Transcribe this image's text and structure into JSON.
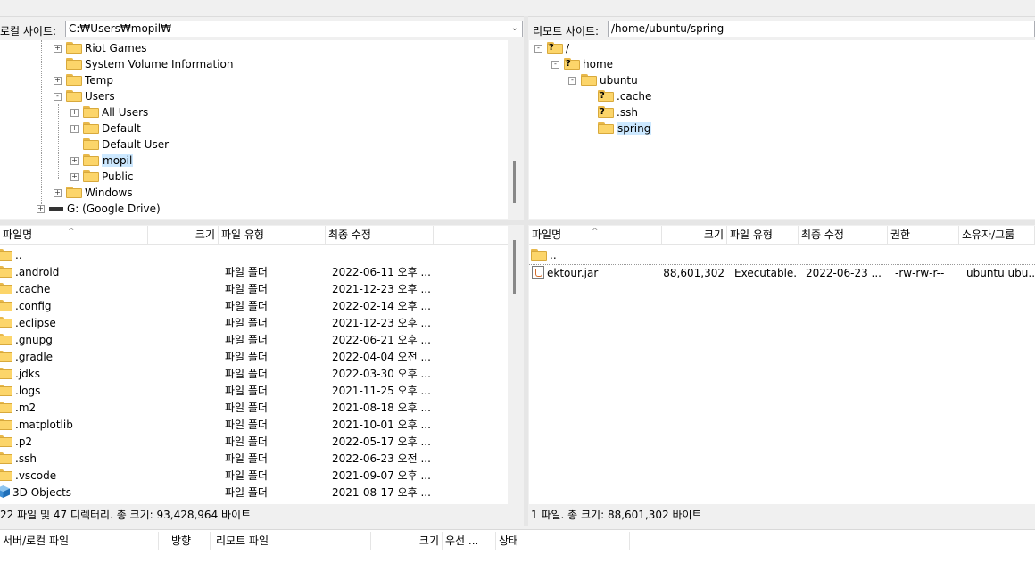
{
  "local_site": {
    "label": "로컬 사이트:",
    "path": "C:₩Users₩mopil₩"
  },
  "remote_site": {
    "label": "리모트 사이트:",
    "path": "/home/ubuntu/spring"
  },
  "local_tree": [
    {
      "name": "Riot Games"
    },
    {
      "name": "System Volume Information"
    },
    {
      "name": "Temp"
    },
    {
      "name": "Users"
    },
    {
      "name": "All Users"
    },
    {
      "name": "Default"
    },
    {
      "name": "Default User"
    },
    {
      "name": "mopil"
    },
    {
      "name": "Public"
    },
    {
      "name": "Windows"
    },
    {
      "name": "G: (Google Drive)"
    }
  ],
  "remote_tree": [
    {
      "name": "/"
    },
    {
      "name": "home"
    },
    {
      "name": "ubuntu"
    },
    {
      "name": ".cache"
    },
    {
      "name": ".ssh"
    },
    {
      "name": "spring"
    }
  ],
  "local_columns": [
    "파일명",
    "크기",
    "파일 유형",
    "최종 수정"
  ],
  "remote_columns": [
    "파일명",
    "크기",
    "파일 유형",
    "최종 수정",
    "권한",
    "소유자/그룹"
  ],
  "local_files": [
    {
      "name": "..",
      "type": "",
      "modified": ""
    },
    {
      "name": ".android",
      "type": "파일 폴더",
      "modified": "2022-06-11 오후 ..."
    },
    {
      "name": ".cache",
      "type": "파일 폴더",
      "modified": "2021-12-23 오후 ..."
    },
    {
      "name": ".config",
      "type": "파일 폴더",
      "modified": "2022-02-14 오후 ..."
    },
    {
      "name": ".eclipse",
      "type": "파일 폴더",
      "modified": "2021-12-23 오후 ..."
    },
    {
      "name": ".gnupg",
      "type": "파일 폴더",
      "modified": "2022-06-21 오후 ..."
    },
    {
      "name": ".gradle",
      "type": "파일 폴더",
      "modified": "2022-04-04 오전 ..."
    },
    {
      "name": ".jdks",
      "type": "파일 폴더",
      "modified": "2022-03-30 오후 ..."
    },
    {
      "name": ".logs",
      "type": "파일 폴더",
      "modified": "2021-11-25 오후 ..."
    },
    {
      "name": ".m2",
      "type": "파일 폴더",
      "modified": "2021-08-18 오후 ..."
    },
    {
      "name": ".matplotlib",
      "type": "파일 폴더",
      "modified": "2021-10-01 오후 ..."
    },
    {
      "name": ".p2",
      "type": "파일 폴더",
      "modified": "2022-05-17 오후 ..."
    },
    {
      "name": ".ssh",
      "type": "파일 폴더",
      "modified": "2022-06-23 오전 ..."
    },
    {
      "name": ".vscode",
      "type": "파일 폴더",
      "modified": "2021-09-07 오후 ..."
    },
    {
      "name": "3D Objects",
      "type": "파일 폴더",
      "modified": "2021-08-17 오후 ..."
    }
  ],
  "remote_files": [
    {
      "name": "..",
      "size": "",
      "type": "",
      "modified": "",
      "perm": "",
      "owner": ""
    },
    {
      "name": "ektour.jar",
      "size": "88,601,302",
      "type": "Executable...",
      "modified": "2022-06-23 ...",
      "perm": "-rw-rw-r--",
      "owner": "ubuntu ubu..."
    }
  ],
  "local_status": "22 파일 및 47 디렉터리. 총 크기: 93,428,964 바이트",
  "remote_status": "1 파일. 총 크기: 88,601,302 바이트",
  "queue_columns": [
    "서버/로컬 파일",
    "방향",
    "리모트 파일",
    "크기",
    "우선 ...",
    "상태"
  ],
  "colors": {
    "folder": "#fcd56a",
    "selection": "#cce8ff",
    "border": "#abadb3"
  }
}
